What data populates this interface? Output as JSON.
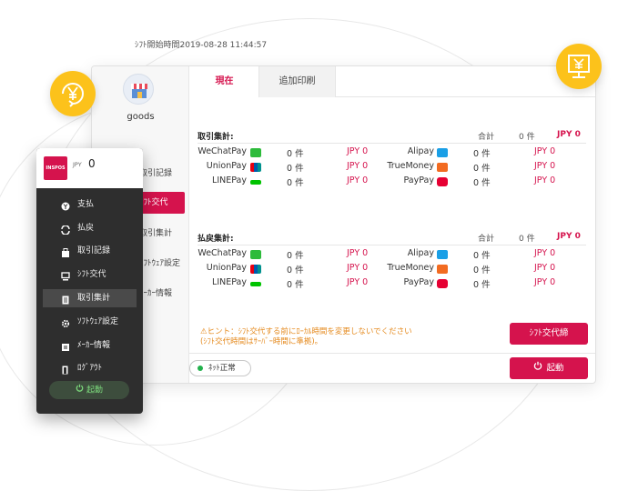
{
  "store": {
    "name": "goods"
  },
  "bg_nav": [
    "取引記録",
    "ｼﾌﾄ交代",
    "取引集計",
    "ｿﾌﾄｳｪｱ設定",
    "ﾒｰｶｰ情報"
  ],
  "tabs": {
    "current": "現在",
    "other": "追加印刷"
  },
  "shift_start": "ｼﾌﾄ開始時間2019-08-28 11:44:57",
  "transaction_summary": {
    "title": "取引集計:",
    "total_label": "合計",
    "total_count": "0 件",
    "total_amount": "JPY 0",
    "left_rows": [
      {
        "name": "WeChatPay",
        "count": "0 件",
        "amount": "JPY 0"
      },
      {
        "name": "UnionPay",
        "count": "0 件",
        "amount": "JPY 0"
      },
      {
        "name": "LINEPay",
        "count": "0 件",
        "amount": "JPY 0"
      }
    ],
    "right_rows": [
      {
        "name": "Alipay",
        "count": "0 件",
        "amount": "JPY 0"
      },
      {
        "name": "TrueMoney",
        "count": "0 件",
        "amount": "JPY 0"
      },
      {
        "name": "PayPay",
        "count": "0 件",
        "amount": "JPY 0"
      }
    ]
  },
  "refund_summary": {
    "title": "払戻集計:",
    "total_label": "合計",
    "total_count": "0 件",
    "total_amount": "JPY 0",
    "left_rows": [
      {
        "name": "WeChatPay",
        "count": "0 件",
        "amount": "JPY 0"
      },
      {
        "name": "UnionPay",
        "count": "0 件",
        "amount": "JPY 0"
      },
      {
        "name": "LINEPay",
        "count": "0 件",
        "amount": "JPY 0"
      }
    ],
    "right_rows": [
      {
        "name": "Alipay",
        "count": "0 件",
        "amount": "JPY 0"
      },
      {
        "name": "TrueMoney",
        "count": "0 件",
        "amount": "JPY 0"
      },
      {
        "name": "PayPay",
        "count": "0 件",
        "amount": "JPY 0"
      }
    ]
  },
  "hint": {
    "line1": "⚠ヒント：ｼﾌﾄ交代する前にﾛｰｶﾙ時間を変更しないでください",
    "line2": "(ｼﾌﾄ交代時間はｻｰﾊﾞｰ時間に準拠)。"
  },
  "buttons": {
    "shift_close": "ｼﾌﾄ交代締",
    "launch": "起動"
  },
  "network_status": "ﾈｯﾄ正常",
  "sidebar": {
    "logo_text": "INSPOS",
    "currency_label": "JPY",
    "currency_value": "0",
    "items": [
      {
        "label": "支払",
        "icon": "payment-icon"
      },
      {
        "label": "払戻",
        "icon": "refund-icon"
      },
      {
        "label": "取引記録",
        "icon": "record-icon"
      },
      {
        "label": "ｼﾌﾄ交代",
        "icon": "shift-icon"
      },
      {
        "label": "取引集計",
        "icon": "summary-icon"
      },
      {
        "label": "ｿﾌﾄｳｪｱ設定",
        "icon": "gear-icon"
      },
      {
        "label": "ﾒｰｶｰ情報",
        "icon": "info-icon"
      },
      {
        "label": "ﾛｸﾞｱｳﾄ",
        "icon": "logout-icon"
      }
    ],
    "launch_label": "起動"
  },
  "colors": {
    "accent": "#d5134d",
    "yellow": "#fcc21b",
    "sidebar_bg": "#2e2e2e",
    "status_green": "#22b14c"
  }
}
